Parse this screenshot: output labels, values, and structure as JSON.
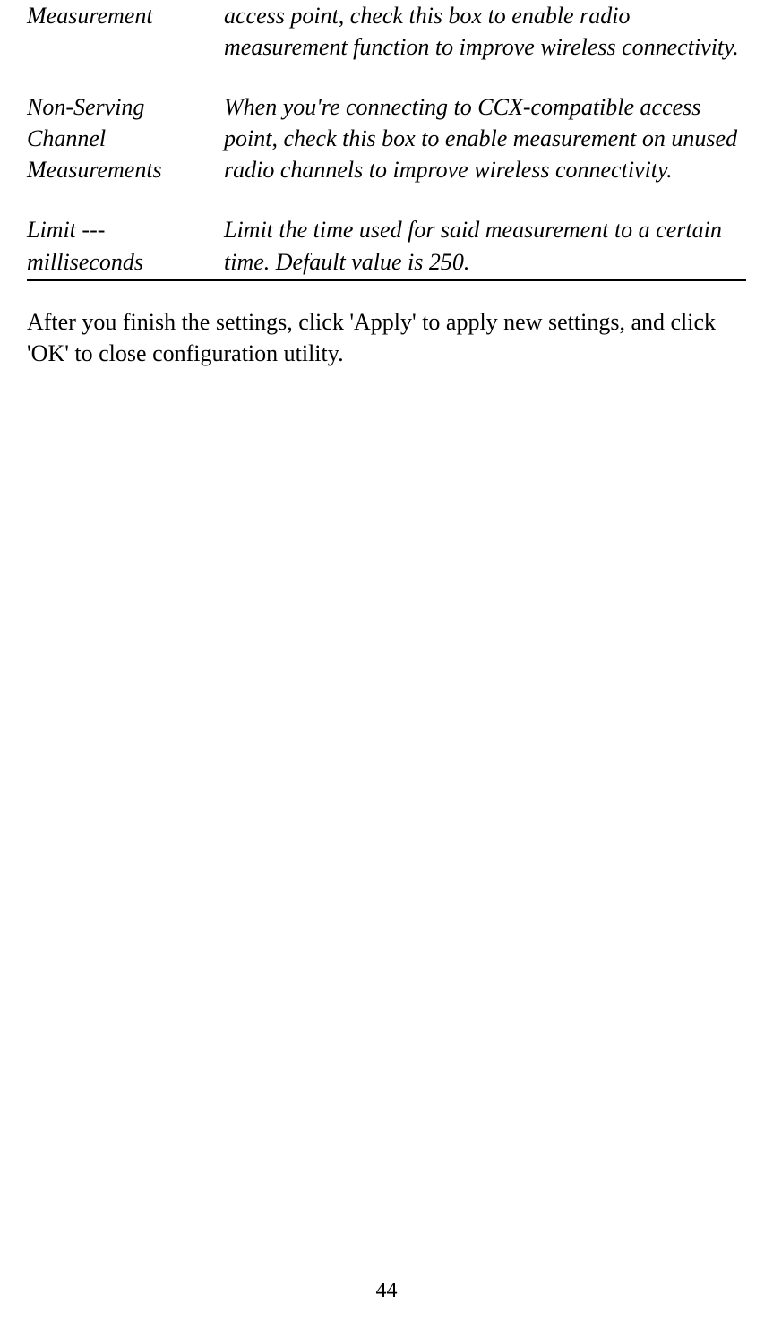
{
  "definitions": {
    "row1": {
      "term": "Measurement",
      "description": "access point, check this box to enable radio measurement function to improve wireless connectivity."
    },
    "row2": {
      "term_line1": "Non-Serving",
      "term_line2": "Channel",
      "term_line3": "Measurements",
      "description": "When you're connecting to CCX-compatible access point, check this box to enable measurement on unused radio channels to improve wireless connectivity."
    },
    "row3": {
      "term_line1": "Limit ---",
      "term_line2": "milliseconds",
      "description": "Limit the time used for said measurement to a certain time. Default value is 250."
    }
  },
  "paragraph": "After you finish the settings, click 'Apply' to apply new settings, and click 'OK' to close configuration utility.",
  "page_number": "44"
}
